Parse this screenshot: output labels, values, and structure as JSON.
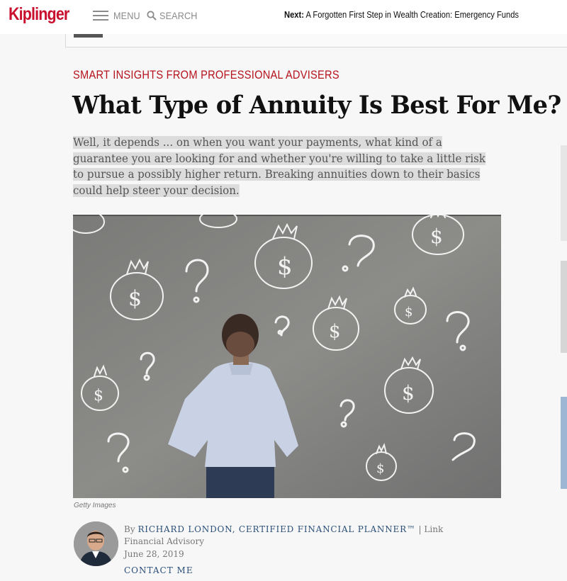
{
  "header": {
    "logo": "Kiplinger",
    "menu_label": "MENU",
    "search_label": "SEARCH",
    "next_prefix": "Next:",
    "next_title": "A Forgotten First Step in Wealth Creation: Emergency Funds"
  },
  "article": {
    "kicker": "SMART INSIGHTS FROM PROFESSIONAL ADVISERS",
    "title": "What Type of Annuity Is Best For Me?",
    "dek_lines": [
      "Well, it depends ... on when you want your payments, what kind of a",
      "guarantee you are looking for and whether you're willing to take a little risk",
      "to pursue a possibly higher return. Breaking annuities down to their basics",
      "could help steer your decision."
    ],
    "image_credit": "Getty Images"
  },
  "byline": {
    "by": "By",
    "author": "RICHARD LONDON, CERTIFIED FINANCIAL PLANNER™",
    "separator": "|",
    "affiliation": "Link Financial Advisory",
    "date": "June 28, 2019",
    "contact_label": "CONTACT ME"
  },
  "colors": {
    "brand_red": "#c8102e",
    "kicker_red": "#b5121b",
    "link_blue": "#2a4f7a"
  }
}
